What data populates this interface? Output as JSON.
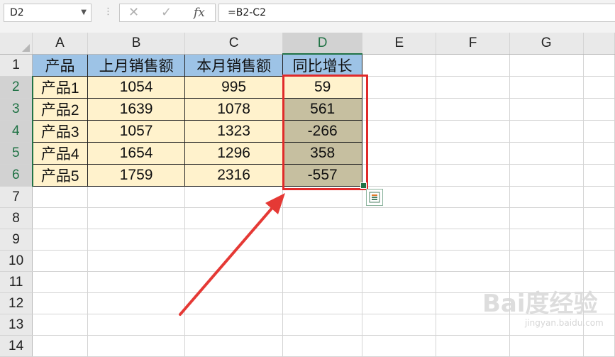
{
  "namebox": {
    "value": "D2"
  },
  "formula_bar": {
    "cancel_glyph": "✕",
    "enter_glyph": "✓",
    "fx_label": "fx",
    "formula": "=B2-C2"
  },
  "columns": [
    "A",
    "B",
    "C",
    "D",
    "E",
    "F",
    "G"
  ],
  "row_numbers": [
    "1",
    "2",
    "3",
    "4",
    "5",
    "6",
    "7",
    "8",
    "9",
    "10",
    "11",
    "12",
    "13",
    "14"
  ],
  "table": {
    "headers": [
      "产品",
      "上月销售额",
      "本月销售额",
      "同比增长"
    ],
    "rows": [
      [
        "产品1",
        "1054",
        "995",
        "59"
      ],
      [
        "产品2",
        "1639",
        "1078",
        "561"
      ],
      [
        "产品3",
        "1057",
        "1323",
        "-266"
      ],
      [
        "产品4",
        "1654",
        "1296",
        "358"
      ],
      [
        "产品5",
        "1759",
        "2316",
        "-557"
      ]
    ]
  },
  "colors": {
    "header_fill": "#9dc3e6",
    "data_fill": "#fff2cc",
    "selection_fill": "#c6bfa0",
    "excel_green": "#217346",
    "annotation_red": "#e02a2a"
  },
  "icons": [
    "chevron-down-icon",
    "cancel-icon",
    "enter-icon",
    "function-icon",
    "quick-analysis-icon",
    "arrow-annotation-icon"
  ],
  "watermark": {
    "brand": "Bai度经验",
    "sub": "jingyan.baidu.com"
  }
}
